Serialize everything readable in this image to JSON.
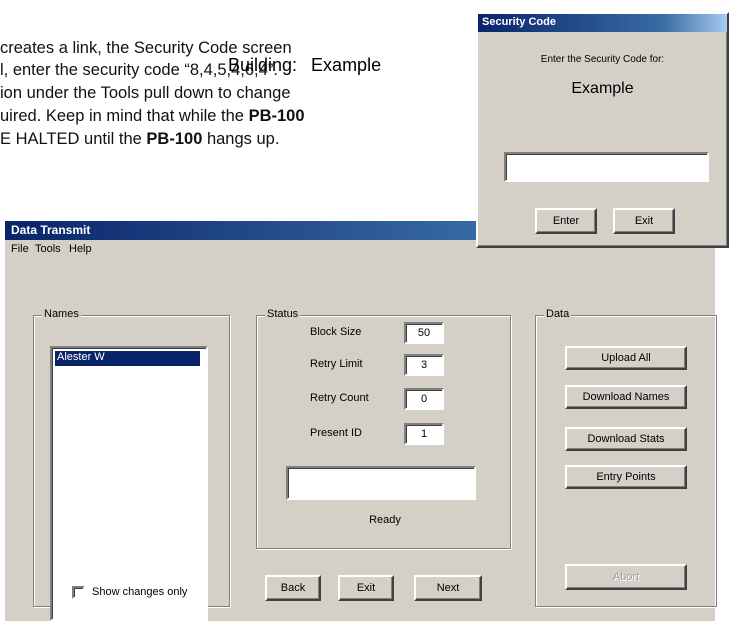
{
  "document": {
    "line1": "creates a link, the Security Code screen",
    "line2": "l, enter the security code “8,4,5,4,6,4”.",
    "line3": "ion under the Tools pull down to change",
    "line4_pre": "uired. Keep in mind that while the ",
    "line4_bold": "PB-100",
    "line5_pre": "E HALTED until the ",
    "line5_bold": "PB-100",
    "line5_post": " hangs up."
  },
  "main_window": {
    "title": "Data Transmit",
    "menu": {
      "file": "File",
      "tools": "Tools",
      "help": "Help"
    },
    "building_label": "Building:",
    "building_name": "Example",
    "names_group": "Names",
    "names_items": [
      "Alester W"
    ],
    "show_changes_label": "Show changes only",
    "status_group": "Status",
    "status_fields": [
      {
        "label": "Block Size",
        "value": "50"
      },
      {
        "label": "Retry Limit",
        "value": "3"
      },
      {
        "label": "Retry Count",
        "value": "0"
      },
      {
        "label": "Present ID",
        "value": "1"
      }
    ],
    "status_text": "Ready",
    "data_group": "Data",
    "data_buttons": [
      "Upload All",
      "Download Names",
      "Download Stats",
      "Entry Points"
    ],
    "abort_label": "Abort",
    "nav_buttons": {
      "back": "Back",
      "exit": "Exit",
      "next": "Next"
    }
  },
  "security_dialog": {
    "title": "Security Code",
    "prompt": "Enter the Security Code for:",
    "name": "Example",
    "input_value": "",
    "enter_label": "Enter",
    "exit_label": "Exit"
  }
}
